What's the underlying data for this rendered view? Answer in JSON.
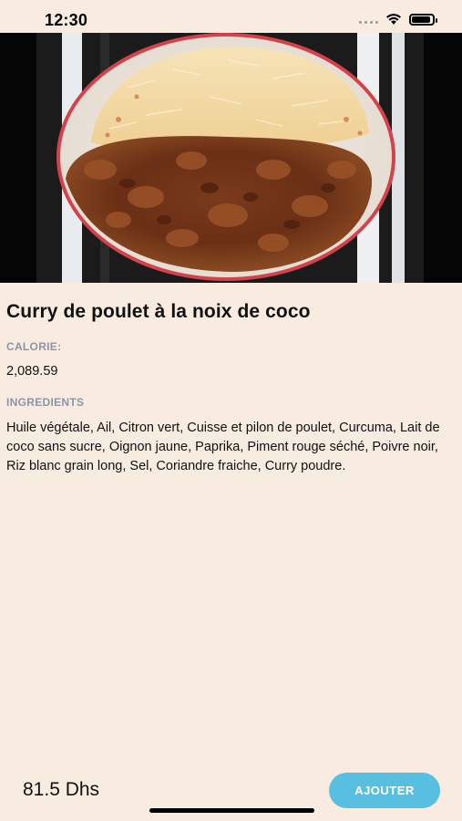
{
  "status_bar": {
    "time": "12:30",
    "icons": [
      "cellular-icon",
      "wifi-icon",
      "battery-icon"
    ],
    "battery_level": 0.9
  },
  "hero": {
    "image": "chicken-curry-rice-photo"
  },
  "dish": {
    "title": "Curry de poulet à la noix de coco",
    "calorie_label": "CALORIE:",
    "calorie_value": "2,089.59",
    "ingredients_label": "INGREDIENTS",
    "ingredients": "Huile végétale, Ail, Citron vert, Cuisse et pilon de poulet, Curcuma, Lait de coco sans sucre, Oignon jaune, Paprika, Piment rouge séché, Poivre noir, Riz blanc grain long, Sel, Coriandre fraiche, Curry poudre."
  },
  "footer": {
    "price": "81.5 Dhs",
    "add_button_label": "AJOUTER"
  },
  "colors": {
    "background": "#f8ebe0",
    "accent_button": "#58bfe0",
    "label_gray": "#8d95a7",
    "plate_rim": "#d3424b"
  }
}
